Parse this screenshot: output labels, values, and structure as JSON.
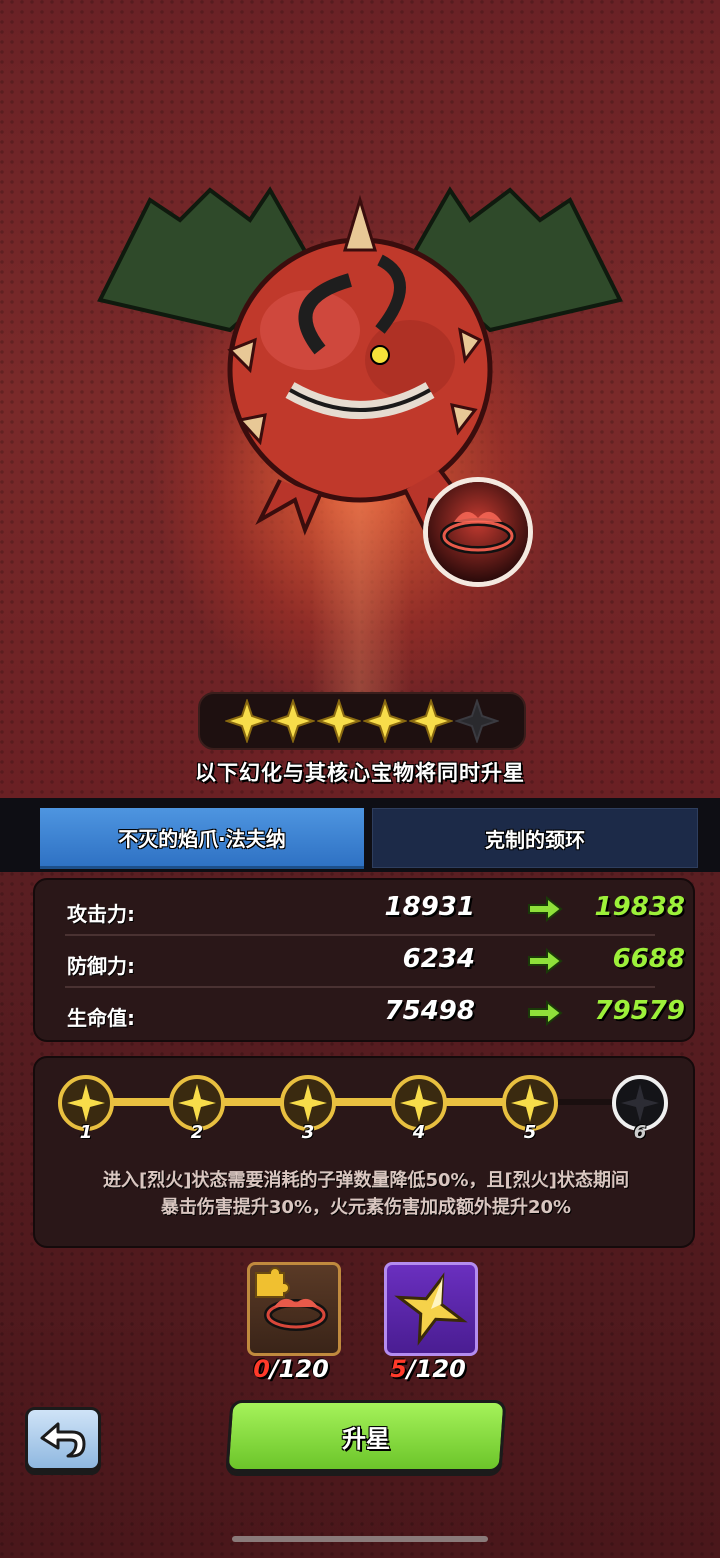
{
  "hero": {
    "monster_icon": "red-winged-demon",
    "core_item_icon": "spiked-collar-orb",
    "stars_filled": 5,
    "stars_total": 6
  },
  "upgrade_note": "以下幻化与其核心宝物将同时升星",
  "tabs": [
    {
      "label": "不灭的焰爪·法夫纳",
      "active": true
    },
    {
      "label": "克制的颈环",
      "active": false
    }
  ],
  "stats": [
    {
      "label": "攻击力:",
      "current": "18931",
      "next": "19838"
    },
    {
      "label": "防御力:",
      "current": "6234",
      "next": "6688"
    },
    {
      "label": "生命值:",
      "current": "75498",
      "next": "79579"
    }
  ],
  "star_progress": {
    "nodes": [
      "1",
      "2",
      "3",
      "4",
      "5",
      "6"
    ],
    "reached": 5,
    "description_line1": "进入[烈火]状态需要消耗的子弹数量降低50%，且[烈火]状态期间",
    "description_line2": "暴击伤害提升30%，火元素伤害加成额外提升20%"
  },
  "materials": [
    {
      "icon": "collar-fragment-icon",
      "have": "0",
      "need": "/120"
    },
    {
      "icon": "gold-star-icon",
      "have": "5",
      "need": "/120"
    }
  ],
  "buttons": {
    "back_icon": "back-arrow-icon",
    "star_up_label": "升星"
  },
  "colors": {
    "stat_next": "#9df03a",
    "tab_active": "#3f86d6",
    "tab_inactive": "#1c2a48",
    "primary_button": "#8ddc40",
    "progress_track": "#e8c040",
    "insufficient": "#ff3a2a"
  }
}
